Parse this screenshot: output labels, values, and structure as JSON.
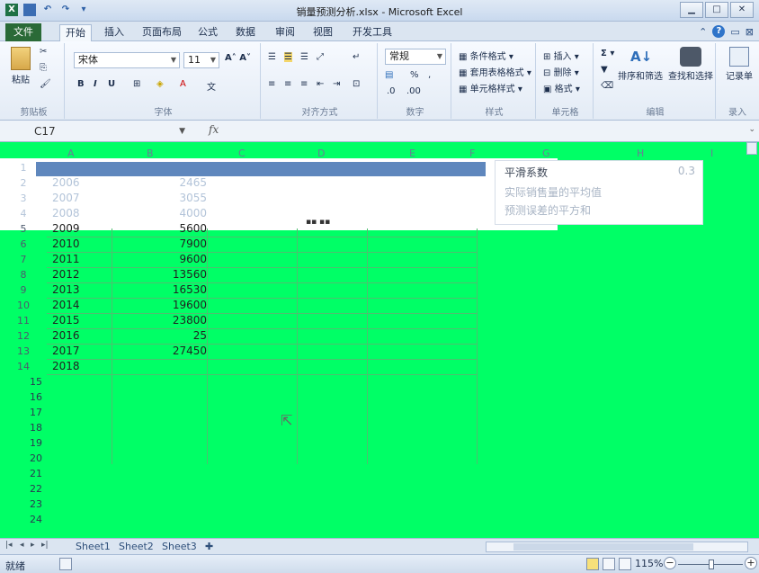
{
  "window": {
    "title": "销量预测分析.xlsx - Microsoft Excel"
  },
  "tabs": [
    "文件",
    "开始",
    "插入",
    "页面布局",
    "公式",
    "数据",
    "审阅",
    "视图",
    "开发工具"
  ],
  "ribbon": {
    "clipboard": {
      "paste": "粘贴",
      "group": "剪贴板"
    },
    "font": {
      "name": "宋体",
      "size": "11",
      "group": "字体",
      "bold": "B",
      "italic": "I",
      "underline": "U"
    },
    "alignment": {
      "group": "对齐方式"
    },
    "number": {
      "format": "常规",
      "percent": "%",
      "comma": ",",
      "group": "数字"
    },
    "styles": {
      "conditional": "条件格式",
      "table": "套用表格格式",
      "cell": "单元格样式",
      "group": "样式"
    },
    "cells": {
      "insert": "插入",
      "delete": "删除",
      "format": "格式",
      "group": "单元格"
    },
    "editing": {
      "sum": "Σ",
      "sort": "排序和筛选",
      "find": "查找和选择",
      "group": "编辑"
    },
    "record": {
      "label": "记录单",
      "group": "录入"
    }
  },
  "formula_bar": {
    "name_box": "C17",
    "fx": "fx",
    "formula": ""
  },
  "columns": [
    "A",
    "B",
    "C",
    "D",
    "E",
    "F",
    "G",
    "H",
    "I"
  ],
  "table": {
    "rows": [
      {
        "row": "1",
        "year": "",
        "sales": ""
      },
      {
        "row": "2",
        "year": "2006",
        "sales": "2465"
      },
      {
        "row": "3",
        "year": "2007",
        "sales": "3055"
      },
      {
        "row": "4",
        "year": "2008",
        "sales": "4000"
      },
      {
        "row": "5",
        "year": "2009",
        "sales": "5600"
      },
      {
        "row": "6",
        "year": "2010",
        "sales": "7900"
      },
      {
        "row": "7",
        "year": "2011",
        "sales": "9600"
      },
      {
        "row": "8",
        "year": "2012",
        "sales": "13560"
      },
      {
        "row": "9",
        "year": "2013",
        "sales": "16530"
      },
      {
        "row": "10",
        "year": "2014",
        "sales": "19600"
      },
      {
        "row": "11",
        "year": "2015",
        "sales": "23800"
      },
      {
        "row": "12",
        "year": "2016",
        "sales": "25"
      },
      {
        "row": "13",
        "year": "2017",
        "sales": "27450"
      },
      {
        "row": "14",
        "year": "2018",
        "sales": ""
      }
    ],
    "empty_rows": [
      "15",
      "16",
      "17",
      "18",
      "19",
      "20",
      "21",
      "22",
      "23",
      "24"
    ]
  },
  "note": {
    "title": "平滑系数",
    "line1": "实际销售量的平均值",
    "line2": "预测误差的平方和",
    "value": "0.3"
  },
  "sheets": [
    "Sheet1",
    "Sheet2",
    "Sheet3"
  ],
  "status": {
    "ready": "就绪",
    "zoom": "115%"
  },
  "colors": {
    "sheet_bg": "#00ff66",
    "file_tab": "#2a6a37",
    "header_fill": "#5f87bd"
  }
}
